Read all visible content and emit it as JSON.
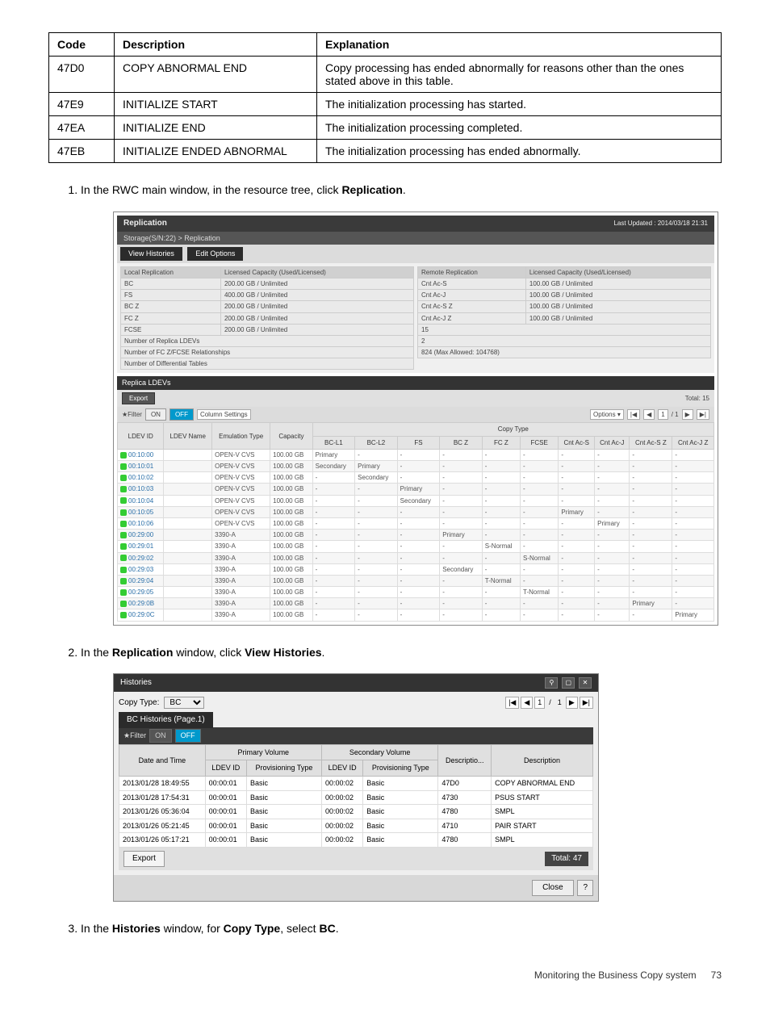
{
  "code_table": {
    "headers": [
      "Code",
      "Description",
      "Explanation"
    ],
    "rows": [
      [
        "47D0",
        "COPY ABNORMAL END",
        "Copy processing has ended abnormally for reasons other than the ones stated above in this table."
      ],
      [
        "47E9",
        "INITIALIZE START",
        "The initialization processing has started."
      ],
      [
        "47EA",
        "INITIALIZE END",
        "The initialization processing completed."
      ],
      [
        "47EB",
        "INITIALIZE ENDED ABNORMAL",
        "The initialization processing has ended abnormally."
      ]
    ]
  },
  "steps": {
    "s1_pre": "In the RWC main window, in the resource tree, click ",
    "s1_bold": "Replication",
    "s1_post": ".",
    "s2_pre": "In the ",
    "s2_b1": "Replication",
    "s2_mid": " window, click ",
    "s2_b2": "View Histories",
    "s2_post": ".",
    "s3_pre": "In the ",
    "s3_b1": "Histories",
    "s3_mid": " window, for ",
    "s3_b2": "Copy Type",
    "s3_mid2": ", select ",
    "s3_b3": "BC",
    "s3_post": "."
  },
  "replication": {
    "title": "Replication",
    "updated": "Last Updated : 2014/03/18 21:31",
    "breadcrumb": "Storage(S/N:22) > Replication",
    "tabs": [
      "View Histories",
      "Edit Options"
    ],
    "local_label": "Local Replication",
    "remote_label": "Remote Replication",
    "lic_label": "Licensed Capacity (Used/Licensed)",
    "local_rows": [
      [
        "BC",
        "200.00 GB / Unlimited"
      ],
      [
        "FS",
        "400.00 GB / Unlimited"
      ],
      [
        "BC Z",
        "200.00 GB / Unlimited"
      ],
      [
        "FC Z",
        "200.00 GB / Unlimited"
      ],
      [
        "FCSE",
        "200.00 GB / Unlimited"
      ]
    ],
    "remote_rows": [
      [
        "Cnt Ac-S",
        "100.00 GB / Unlimited"
      ],
      [
        "Cnt Ac-J",
        "100.00 GB / Unlimited"
      ],
      [
        "Cnt Ac-S Z",
        "100.00 GB / Unlimited"
      ],
      [
        "Cnt Ac-J Z",
        "100.00 GB / Unlimited"
      ]
    ],
    "counts": [
      [
        "Number of Replica LDEVs",
        "15"
      ],
      [
        "Number of FC Z/FCSE Relationships",
        "2"
      ],
      [
        "Number of Differential Tables",
        "824 (Max Allowed: 104768)"
      ]
    ],
    "replica_section": "Replica LDEVs",
    "export": "Export",
    "total": "Total: 15",
    "filter": "★Filter",
    "on": "ON",
    "off": "OFF",
    "col_settings": "Column Settings",
    "options": "Options ▾",
    "page_cur": "1",
    "page_total": "/ 1",
    "table_headers": [
      "LDEV ID",
      "LDEV Name",
      "Emulation Type",
      "Capacity",
      "BC-L1",
      "BC-L2",
      "FS",
      "BC Z",
      "FC Z",
      "FCSE",
      "Cnt Ac-S",
      "Cnt Ac-J",
      "Cnt Ac-S Z",
      "Cnt Ac-J Z"
    ],
    "copy_type_group": "Copy Type",
    "rows": [
      [
        "00:10:00",
        "",
        "OPEN-V CVS",
        "100.00 GB",
        "Primary",
        "-",
        "-",
        "-",
        "-",
        "-",
        "-",
        "-",
        "-",
        "-"
      ],
      [
        "00:10:01",
        "",
        "OPEN-V CVS",
        "100.00 GB",
        "Secondary",
        "Primary",
        "-",
        "-",
        "-",
        "-",
        "-",
        "-",
        "-",
        "-"
      ],
      [
        "00:10:02",
        "",
        "OPEN-V CVS",
        "100.00 GB",
        "-",
        "Secondary",
        "-",
        "-",
        "-",
        "-",
        "-",
        "-",
        "-",
        "-"
      ],
      [
        "00:10:03",
        "",
        "OPEN-V CVS",
        "100.00 GB",
        "-",
        "-",
        "Primary",
        "-",
        "-",
        "-",
        "-",
        "-",
        "-",
        "-"
      ],
      [
        "00:10:04",
        "",
        "OPEN-V CVS",
        "100.00 GB",
        "-",
        "-",
        "Secondary",
        "-",
        "-",
        "-",
        "-",
        "-",
        "-",
        "-"
      ],
      [
        "00:10:05",
        "",
        "OPEN-V CVS",
        "100.00 GB",
        "-",
        "-",
        "-",
        "-",
        "-",
        "-",
        "Primary",
        "-",
        "-",
        "-"
      ],
      [
        "00:10:06",
        "",
        "OPEN-V CVS",
        "100.00 GB",
        "-",
        "-",
        "-",
        "-",
        "-",
        "-",
        "-",
        "Primary",
        "-",
        "-"
      ],
      [
        "00:29:00",
        "",
        "3390-A",
        "100.00 GB",
        "-",
        "-",
        "-",
        "Primary",
        "-",
        "-",
        "-",
        "-",
        "-",
        "-"
      ],
      [
        "00:29:01",
        "",
        "3390-A",
        "100.00 GB",
        "-",
        "-",
        "-",
        "-",
        "S-Normal",
        "-",
        "-",
        "-",
        "-",
        "-"
      ],
      [
        "00:29:02",
        "",
        "3390-A",
        "100.00 GB",
        "-",
        "-",
        "-",
        "-",
        "-",
        "S-Normal",
        "-",
        "-",
        "-",
        "-"
      ],
      [
        "00:29:03",
        "",
        "3390-A",
        "100.00 GB",
        "-",
        "-",
        "-",
        "Secondary",
        "-",
        "-",
        "-",
        "-",
        "-",
        "-"
      ],
      [
        "00:29:04",
        "",
        "3390-A",
        "100.00 GB",
        "-",
        "-",
        "-",
        "-",
        "T-Normal",
        "-",
        "-",
        "-",
        "-",
        "-"
      ],
      [
        "00:29:05",
        "",
        "3390-A",
        "100.00 GB",
        "-",
        "-",
        "-",
        "-",
        "-",
        "T-Normal",
        "-",
        "-",
        "-",
        "-"
      ],
      [
        "00:29:0B",
        "",
        "3390-A",
        "100.00 GB",
        "-",
        "-",
        "-",
        "-",
        "-",
        "-",
        "-",
        "-",
        "Primary",
        "-"
      ],
      [
        "00:29:0C",
        "",
        "3390-A",
        "100.00 GB",
        "-",
        "-",
        "-",
        "-",
        "-",
        "-",
        "-",
        "-",
        "-",
        "Primary"
      ]
    ]
  },
  "histories": {
    "title": "Histories",
    "copy_type_label": "Copy Type:",
    "copy_type_value": "BC",
    "page_cur": "1",
    "page_sep": "/",
    "page_total": "1",
    "tab": "BC Histories (Page.1)",
    "filter": "★Filter",
    "on": "ON",
    "off": "OFF",
    "group_primary": "Primary Volume",
    "group_secondary": "Secondary Volume",
    "headers": [
      "Date and Time",
      "LDEV ID",
      "Provisioning Type",
      "LDEV ID",
      "Provisioning Type",
      "Descriptio...",
      "Description"
    ],
    "rows": [
      [
        "2013/01/28 18:49:55",
        "00:00:01",
        "Basic",
        "00:00:02",
        "Basic",
        "47D0",
        "COPY ABNORMAL END"
      ],
      [
        "2013/01/28 17:54:31",
        "00:00:01",
        "Basic",
        "00:00:02",
        "Basic",
        "4730",
        "PSUS START"
      ],
      [
        "2013/01/26 05:36:04",
        "00:00:01",
        "Basic",
        "00:00:02",
        "Basic",
        "4780",
        "SMPL"
      ],
      [
        "2013/01/26 05:21:45",
        "00:00:01",
        "Basic",
        "00:00:02",
        "Basic",
        "4710",
        "PAIR START"
      ],
      [
        "2013/01/26 05:17:21",
        "00:00:01",
        "Basic",
        "00:00:02",
        "Basic",
        "4780",
        "SMPL"
      ]
    ],
    "export": "Export",
    "total_label": "Total:",
    "total_value": "47",
    "close": "Close",
    "help": "?"
  },
  "footer": {
    "section": "Monitoring the Business Copy system",
    "page": "73"
  }
}
